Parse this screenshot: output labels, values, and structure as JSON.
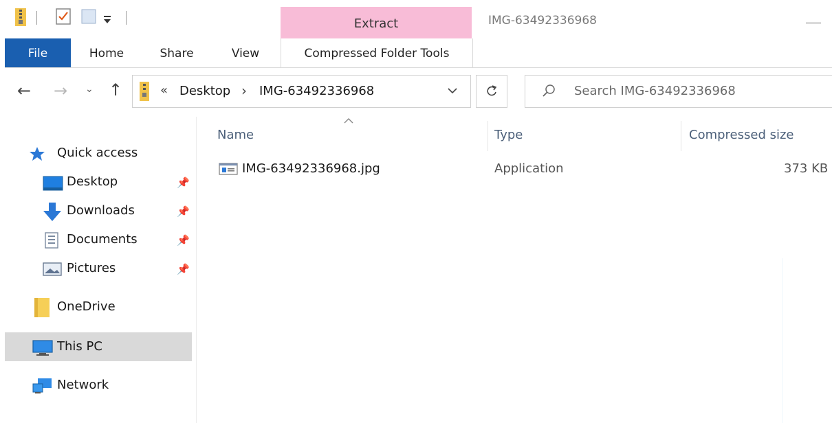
{
  "titlebar": {
    "extract_tab": "Extract",
    "window_title": "IMG-63492336968"
  },
  "ribbon": {
    "tabs": [
      "File",
      "Home",
      "Share",
      "View",
      "Compressed Folder Tools"
    ]
  },
  "address": {
    "overflow": "«",
    "crumbs": [
      "Desktop",
      "IMG-63492336968"
    ],
    "separator": "›"
  },
  "search": {
    "placeholder": "Search IMG-63492336968"
  },
  "sidebar": {
    "items": [
      {
        "label": "Quick access",
        "icon": "star-icon"
      },
      {
        "label": "Desktop",
        "icon": "desktop-icon",
        "pinned": true
      },
      {
        "label": "Downloads",
        "icon": "download-arrow-icon",
        "pinned": true
      },
      {
        "label": "Documents",
        "icon": "documents-icon",
        "pinned": true
      },
      {
        "label": "Pictures",
        "icon": "pictures-icon",
        "pinned": true
      },
      {
        "label": "OneDrive",
        "icon": "folder-icon"
      },
      {
        "label": "This PC",
        "icon": "monitor-icon",
        "selected": true
      },
      {
        "label": "Network",
        "icon": "network-icon"
      }
    ]
  },
  "columns": {
    "name": "Name",
    "type": "Type",
    "compressed_size": "Compressed size"
  },
  "files": [
    {
      "name": "IMG-63492336968.jpg",
      "type": "Application",
      "size": "373 KB",
      "icon": "application-icon"
    }
  ],
  "colors": {
    "file_tab": "#1a5fb0",
    "extract_tab": "#f8bcd7",
    "selection": "#d9d9d9",
    "column_header": "#4c607a"
  }
}
